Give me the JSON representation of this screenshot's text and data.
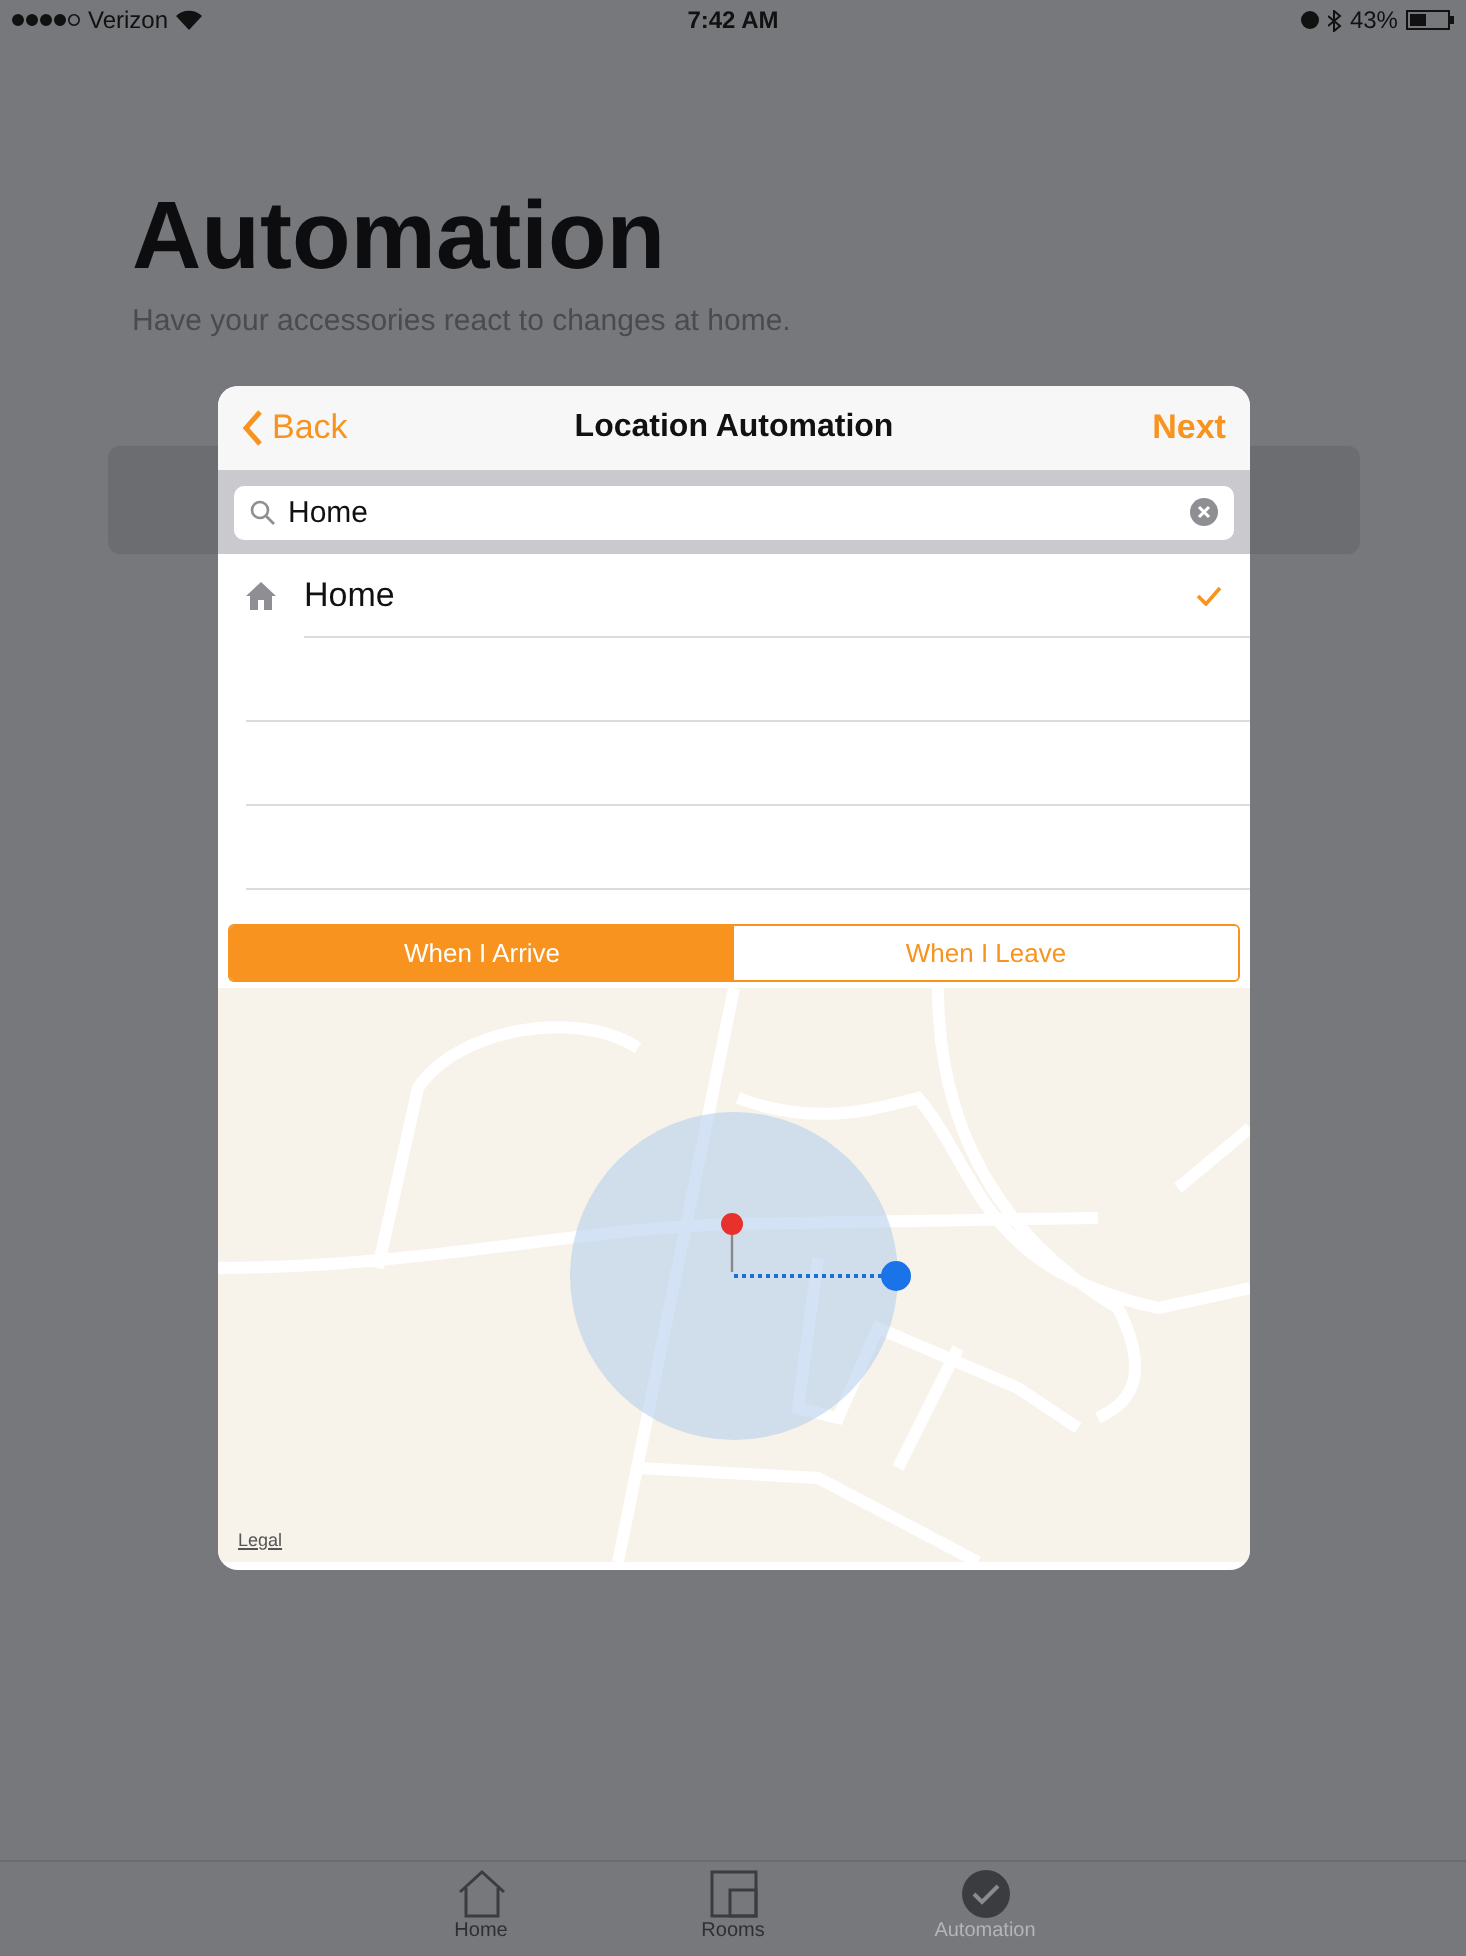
{
  "status_bar": {
    "carrier": "Verizon",
    "time": "7:42 AM",
    "battery": "43%"
  },
  "header": {
    "title": "Automation",
    "subtitle": "Have your accessories react to changes at home."
  },
  "modal": {
    "back": "Back",
    "title": "Location Automation",
    "next": "Next",
    "search": {
      "value": "Home"
    },
    "results": [
      {
        "label": "Home",
        "checked": true
      }
    ],
    "segments": [
      {
        "label": "When I Arrive",
        "selected": true
      },
      {
        "label": "When I Leave",
        "selected": false
      }
    ],
    "map": {
      "legal": "Legal"
    }
  },
  "tab_bar": [
    {
      "label": "Home",
      "kind": "house",
      "selected": false
    },
    {
      "label": "Rooms",
      "kind": "rooms",
      "selected": false
    },
    {
      "label": "Automation",
      "kind": "check",
      "selected": true
    }
  ]
}
